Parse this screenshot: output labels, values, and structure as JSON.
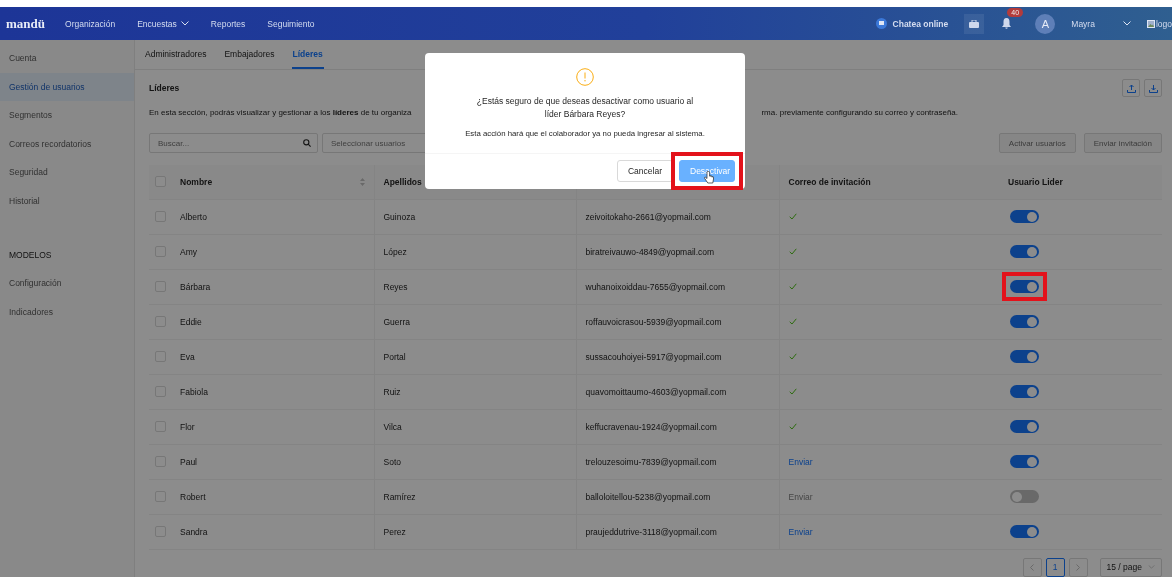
{
  "nav": {
    "logo": "mandü",
    "items": [
      {
        "label": "Organización",
        "dropdown": false
      },
      {
        "label": "Encuestas",
        "dropdown": true
      },
      {
        "label": "Reportes",
        "dropdown": false
      },
      {
        "label": "Seguimiento",
        "dropdown": false
      }
    ],
    "chat": "Chatea online",
    "notifications": "40",
    "avatar": "A",
    "user": "Mayra",
    "logo_alt": "logo"
  },
  "sidebar": {
    "items": [
      {
        "kind": "item",
        "label": "Cuenta",
        "selected": false
      },
      {
        "kind": "item",
        "label": "Gestión de usuarios",
        "selected": true
      },
      {
        "kind": "item",
        "label": "Segmentos",
        "selected": false
      },
      {
        "kind": "item",
        "label": "Correos recordatorios",
        "selected": false
      },
      {
        "kind": "item",
        "label": "Seguridad",
        "selected": false
      },
      {
        "kind": "item",
        "label": "Historial",
        "selected": false
      },
      {
        "kind": "heading",
        "label": "MODELOS"
      },
      {
        "kind": "item",
        "label": "Configuración",
        "selected": false
      },
      {
        "kind": "item",
        "label": "Indicadores",
        "selected": false
      }
    ]
  },
  "tabs": [
    {
      "label": "Administradores",
      "selected": false
    },
    {
      "label": "Embajadores",
      "selected": false
    },
    {
      "label": "Líderes",
      "selected": true
    }
  ],
  "section": {
    "title": "Líderes",
    "description_start": "En esta sección, podrás visualizar y gestionar a los **líderes** de tu organiza",
    "description_end": "rma. previamente configurando su correo y contraseña."
  },
  "toolbar": {
    "search": {
      "placeholder": "Buscar..."
    },
    "select": {
      "placeholder": "Seleccionar usuarios"
    },
    "buttons": [
      {
        "label": "Activar usuarios",
        "disabled": true
      },
      {
        "label": "Enviar invitación",
        "disabled": true
      }
    ]
  },
  "table": {
    "header_checked": false,
    "columns": [
      {
        "label": "Nombre",
        "sortable": true
      },
      {
        "label": "Apellidos",
        "sortable": false
      },
      {
        "label": "Correo de invitación",
        "sortable": false
      },
      {
        "label": "Usuario Lider",
        "sortable": false
      }
    ],
    "rows": [
      {
        "checked": false,
        "name": "Alberto",
        "surname": "Guinoza",
        "email": "zeivoitokaho-2661@yopmail.com",
        "invitation": {
          "kind": "sent"
        },
        "leader": true,
        "highlighted": false
      },
      {
        "checked": false,
        "name": "Amy",
        "surname": "López",
        "email": "biratreivauwo-4849@yopmail.com",
        "invitation": {
          "kind": "sent"
        },
        "leader": true,
        "highlighted": false
      },
      {
        "checked": false,
        "name": "Bárbara",
        "surname": "Reyes",
        "email": "wuhanoixoiddau-7655@yopmail.com",
        "invitation": {
          "kind": "sent"
        },
        "leader": true,
        "highlighted": true
      },
      {
        "checked": false,
        "name": "Eddie",
        "surname": "Guerra",
        "email": "roffauvoicrasou-5939@yopmail.com",
        "invitation": {
          "kind": "sent"
        },
        "leader": true,
        "highlighted": false
      },
      {
        "checked": false,
        "name": "Eva",
        "surname": "Portal",
        "email": "sussacouhoiyei-5917@yopmail.com",
        "invitation": {
          "kind": "sent"
        },
        "leader": true,
        "highlighted": false
      },
      {
        "checked": false,
        "name": "Fabiola",
        "surname": "Ruiz",
        "email": "quavomoittaumo-4603@yopmail.com",
        "invitation": {
          "kind": "sent"
        },
        "leader": true,
        "highlighted": false
      },
      {
        "checked": false,
        "name": "Flor",
        "surname": "Vilca",
        "email": "keffucravenau-1924@yopmail.com",
        "invitation": {
          "kind": "sent"
        },
        "leader": true,
        "highlighted": false
      },
      {
        "checked": false,
        "name": "Paul",
        "surname": "Soto",
        "email": "trelouzesoimu-7839@yopmail.com",
        "invitation": {
          "kind": "link",
          "label": "Enviar",
          "disabled": false
        },
        "leader": true,
        "highlighted": false
      },
      {
        "checked": false,
        "name": "Robert",
        "surname": "Ramírez",
        "email": "balloloitellou-5238@yopmail.com",
        "invitation": {
          "kind": "link",
          "label": "Enviar",
          "disabled": true
        },
        "leader": false,
        "highlighted": false
      },
      {
        "checked": false,
        "name": "Sandra",
        "surname": "Perez",
        "email": "praujeddutrive-3118@yopmail.com",
        "invitation": {
          "kind": "link",
          "label": "Enviar",
          "disabled": false
        },
        "leader": true,
        "highlighted": false
      }
    ]
  },
  "pagination": {
    "pages": [
      {
        "label": "1",
        "selected": true
      }
    ],
    "page_size": "15 / page"
  },
  "modal": {
    "title": "¿Estás seguro de que deseas desactivar como usuario al líder Bárbara Reyes?",
    "message": "Esta acción hará que el colaborador ya no pueda ingresar al sistema.",
    "buttons": [
      {
        "label": "Cancelar",
        "kind": "default",
        "highlighted": false,
        "hovered": false
      },
      {
        "label": "Desactivar",
        "kind": "primary",
        "highlighted": true,
        "hovered": true
      }
    ]
  }
}
